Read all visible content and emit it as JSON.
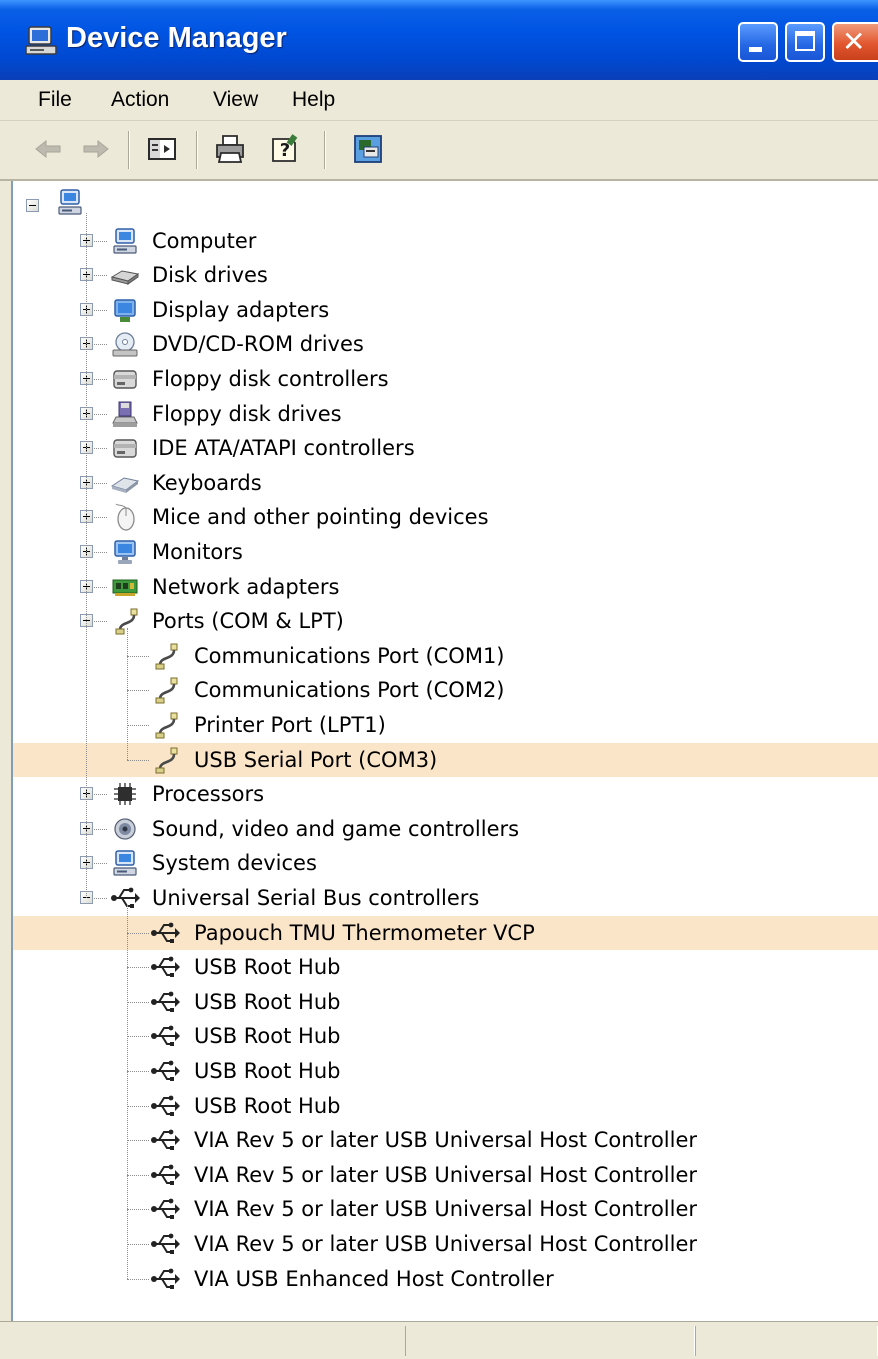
{
  "window": {
    "title": "Device Manager"
  },
  "menu": [
    "File",
    "Action",
    "View",
    "Help"
  ],
  "toolbar": {
    "buttons": [
      "back-arrow-icon",
      "forward-arrow-icon",
      "show-hide-console-tree-icon",
      "print-icon",
      "help-icon",
      "properties-icon"
    ]
  },
  "tree": {
    "root_icon": "computer-icon",
    "categories": [
      {
        "label": "Computer",
        "icon": "computer-icon",
        "expanded": false
      },
      {
        "label": "Disk drives",
        "icon": "disk-drive-icon",
        "expanded": false
      },
      {
        "label": "Display adapters",
        "icon": "display-adapter-icon",
        "expanded": false
      },
      {
        "label": "DVD/CD-ROM drives",
        "icon": "dvd-drive-icon",
        "expanded": false
      },
      {
        "label": "Floppy disk controllers",
        "icon": "controller-icon",
        "expanded": false
      },
      {
        "label": "Floppy disk drives",
        "icon": "floppy-drive-icon",
        "expanded": false
      },
      {
        "label": "IDE ATA/ATAPI controllers",
        "icon": "controller-icon",
        "expanded": false
      },
      {
        "label": "Keyboards",
        "icon": "keyboard-icon",
        "expanded": false
      },
      {
        "label": "Mice and other pointing devices",
        "icon": "mouse-icon",
        "expanded": false
      },
      {
        "label": "Monitors",
        "icon": "monitor-icon",
        "expanded": false
      },
      {
        "label": "Network adapters",
        "icon": "network-adapter-icon",
        "expanded": false
      },
      {
        "label": "Ports (COM & LPT)",
        "icon": "port-icon",
        "expanded": true,
        "children": [
          {
            "label": "Communications Port (COM1)",
            "icon": "port-icon",
            "selected": false
          },
          {
            "label": "Communications Port (COM2)",
            "icon": "port-icon",
            "selected": false
          },
          {
            "label": "Printer Port (LPT1)",
            "icon": "port-icon",
            "selected": false
          },
          {
            "label": "USB Serial Port (COM3)",
            "icon": "port-icon",
            "selected": true
          }
        ]
      },
      {
        "label": "Processors",
        "icon": "processor-icon",
        "expanded": false
      },
      {
        "label": "Sound, video and game controllers",
        "icon": "sound-icon",
        "expanded": false
      },
      {
        "label": "System devices",
        "icon": "computer-icon",
        "expanded": false
      },
      {
        "label": "Universal Serial Bus controllers",
        "icon": "usb-icon",
        "expanded": true,
        "children": [
          {
            "label": "Papouch TMU Thermometer VCP",
            "icon": "usb-icon",
            "selected": true
          },
          {
            "label": "USB Root Hub",
            "icon": "usb-icon",
            "selected": false
          },
          {
            "label": "USB Root Hub",
            "icon": "usb-icon",
            "selected": false
          },
          {
            "label": "USB Root Hub",
            "icon": "usb-icon",
            "selected": false
          },
          {
            "label": "USB Root Hub",
            "icon": "usb-icon",
            "selected": false
          },
          {
            "label": "USB Root Hub",
            "icon": "usb-icon",
            "selected": false
          },
          {
            "label": "VIA Rev 5 or later USB Universal Host Controller",
            "icon": "usb-icon",
            "selected": false
          },
          {
            "label": "VIA Rev 5 or later USB Universal Host Controller",
            "icon": "usb-icon",
            "selected": false
          },
          {
            "label": "VIA Rev 5 or later USB Universal Host Controller",
            "icon": "usb-icon",
            "selected": false
          },
          {
            "label": "VIA Rev 5 or later USB Universal Host Controller",
            "icon": "usb-icon",
            "selected": false
          },
          {
            "label": "VIA USB Enhanced Host Controller",
            "icon": "usb-icon",
            "selected": false
          }
        ]
      }
    ]
  },
  "colors": {
    "title_bar": "#0054e3",
    "selection_highlight": "#fbe5c9",
    "close_button": "#e2572f",
    "window_face": "#ece9d8"
  }
}
